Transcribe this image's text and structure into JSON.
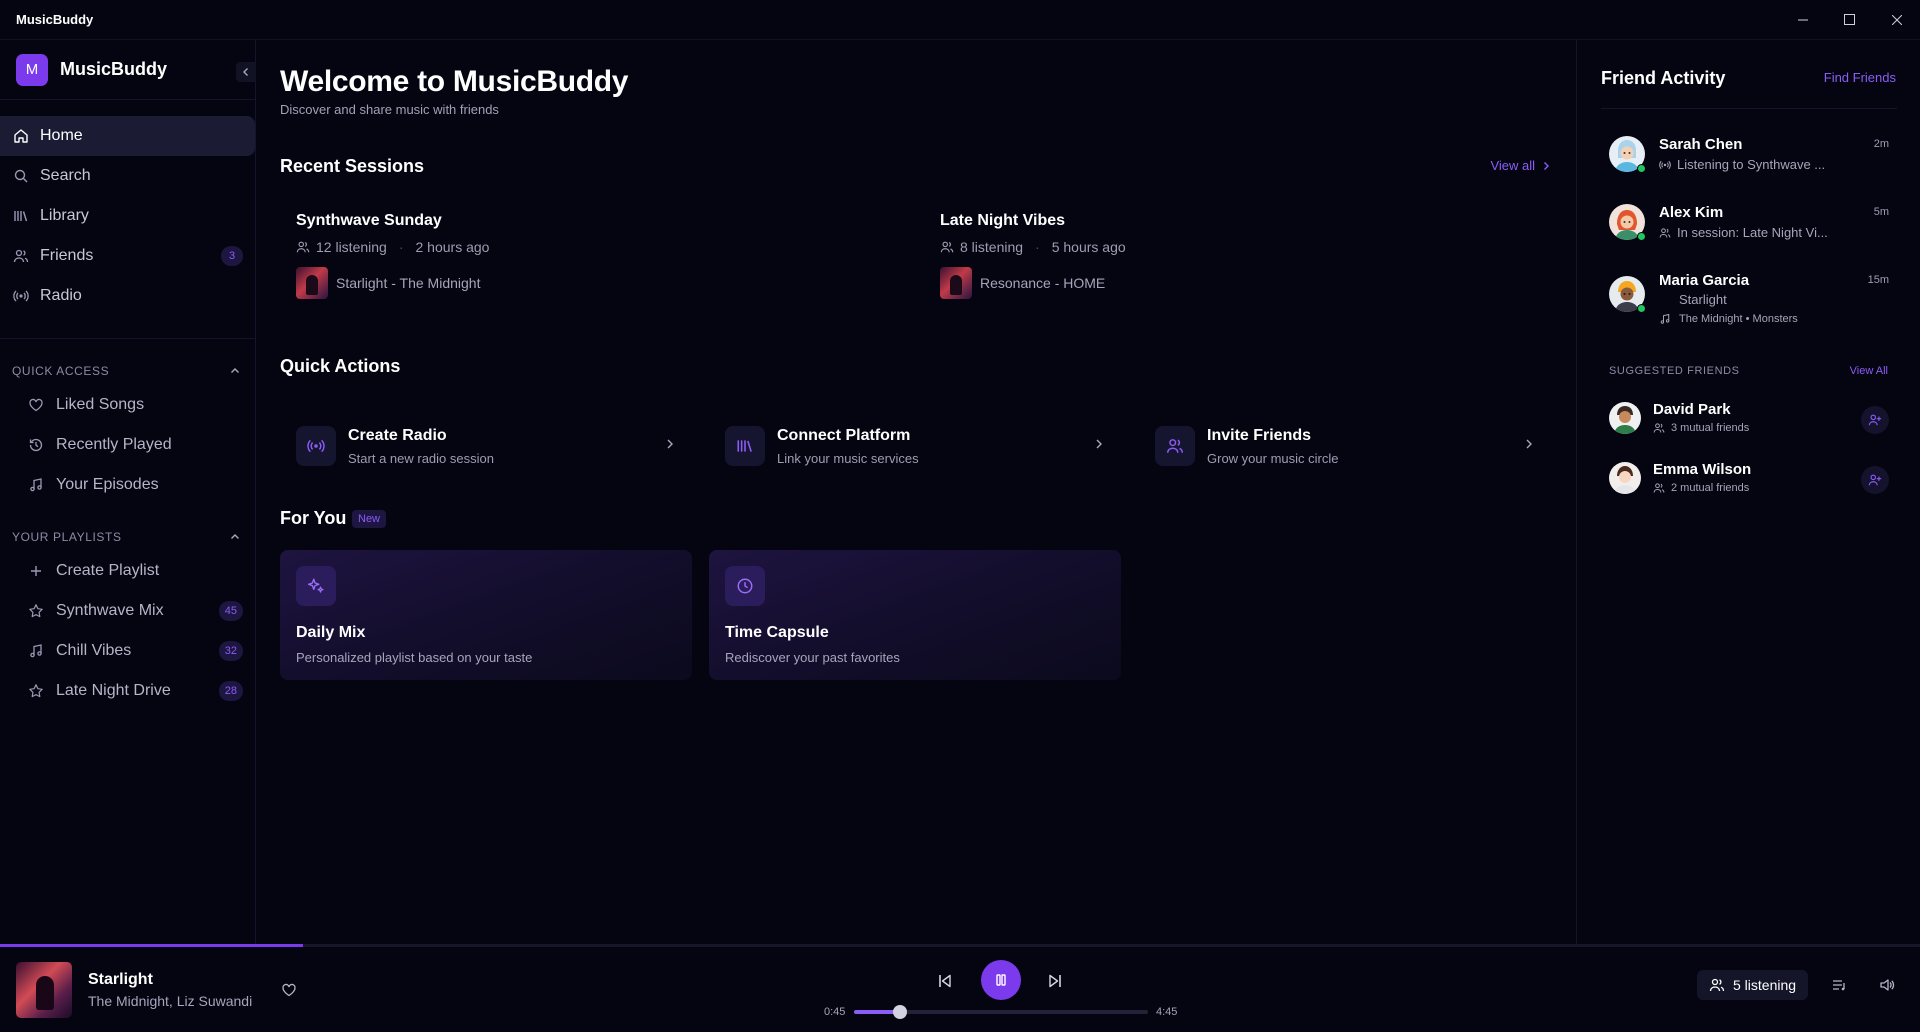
{
  "window": {
    "title": "MusicBuddy"
  },
  "sidebar": {
    "brand": {
      "logo_letter": "M",
      "name": "MusicBuddy"
    },
    "nav": [
      {
        "label": "Home",
        "icon": "home-icon",
        "active": true
      },
      {
        "label": "Search",
        "icon": "search-icon"
      },
      {
        "label": "Library",
        "icon": "library-icon"
      },
      {
        "label": "Friends",
        "icon": "users-icon",
        "badge": "3"
      },
      {
        "label": "Radio",
        "icon": "radio-icon"
      }
    ],
    "quick_access": {
      "heading": "QUICK ACCESS",
      "items": [
        {
          "label": "Liked Songs",
          "icon": "heart-icon"
        },
        {
          "label": "Recently Played",
          "icon": "history-icon"
        },
        {
          "label": "Your Episodes",
          "icon": "music-note-icon"
        }
      ]
    },
    "playlists": {
      "heading": "YOUR PLAYLISTS",
      "create_label": "Create Playlist",
      "items": [
        {
          "label": "Synthwave Mix",
          "count": "45",
          "icon": "star-icon"
        },
        {
          "label": "Chill Vibes",
          "count": "32",
          "icon": "music-note-icon"
        },
        {
          "label": "Late Night Drive",
          "count": "28",
          "icon": "star-icon"
        }
      ]
    }
  },
  "main": {
    "title": "Welcome to MusicBuddy",
    "subtitle": "Discover and share music with friends",
    "recent": {
      "heading": "Recent Sessions",
      "view_all": "View all",
      "sessions": [
        {
          "title": "Synthwave Sunday",
          "listening": "12 listening",
          "time": "2 hours ago",
          "track": "Starlight - The Midnight"
        },
        {
          "title": "Late Night Vibes",
          "listening": "8 listening",
          "time": "5 hours ago",
          "track": "Resonance - HOME"
        }
      ]
    },
    "quick_actions": {
      "heading": "Quick Actions",
      "items": [
        {
          "title": "Create Radio",
          "desc": "Start a new radio session",
          "icon": "radio-icon"
        },
        {
          "title": "Connect Platform",
          "desc": "Link your music services",
          "icon": "library-icon"
        },
        {
          "title": "Invite Friends",
          "desc": "Grow your music circle",
          "icon": "users-icon"
        }
      ]
    },
    "for_you": {
      "heading": "For You",
      "badge": "New",
      "cards": [
        {
          "title": "Daily Mix",
          "desc": "Personalized playlist based on your taste",
          "icon": "sparkles-icon"
        },
        {
          "title": "Time Capsule",
          "desc": "Rediscover your past favorites",
          "icon": "clock-icon"
        }
      ]
    }
  },
  "friend_activity": {
    "title": "Friend Activity",
    "find_friends": "Find Friends",
    "friends": [
      {
        "name": "Sarah Chen",
        "time": "2m",
        "activity": "Listening to Synthwave ...",
        "icon": "radio-icon",
        "online": true
      },
      {
        "name": "Alex Kim",
        "time": "5m",
        "activity": "In session: Late Night Vi...",
        "icon": "users-icon",
        "online": true
      },
      {
        "name": "Maria Garcia",
        "time": "15m",
        "activity": "Starlight",
        "sub": "The Midnight • Monsters",
        "icon": "music-note-icon",
        "online": true
      }
    ],
    "suggested": {
      "heading": "SUGGESTED FRIENDS",
      "view_all": "View All",
      "items": [
        {
          "name": "David Park",
          "mutual": "3 mutual friends"
        },
        {
          "name": "Emma Wilson",
          "mutual": "2 mutual friends"
        }
      ]
    }
  },
  "player": {
    "track": "Starlight",
    "artist": "The Midnight, Liz Suwandi",
    "elapsed": "0:45",
    "duration": "4:45",
    "progress": 0.158,
    "listening": "5 listening"
  },
  "colors": {
    "accent": "#7c3aed",
    "accent_text": "#8b5cf6",
    "online": "#22c55e",
    "background": "#050511"
  }
}
